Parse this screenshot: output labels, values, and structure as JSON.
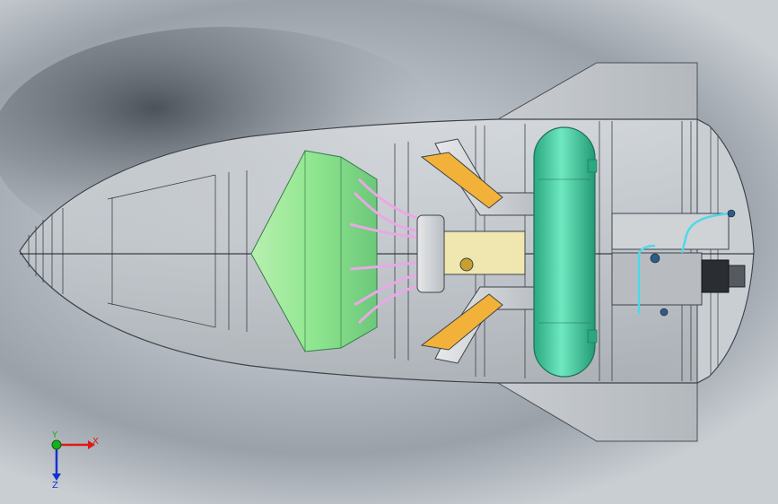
{
  "triad": {
    "x_label": "X",
    "y_label": "Y",
    "z_label": "Z",
    "x_color": "#e01818",
    "y_color": "#18b018",
    "z_color": "#1830d0"
  },
  "colors": {
    "background": "#b7bdc4",
    "shell": "#c4c9ce",
    "tank_green": "#4fd4a8",
    "cone_green": "#8fe68f",
    "bracket_orange": "#f2b23a",
    "tubing_pink": "#e9a8e6",
    "coolant_cyan": "#4fd8e8"
  }
}
